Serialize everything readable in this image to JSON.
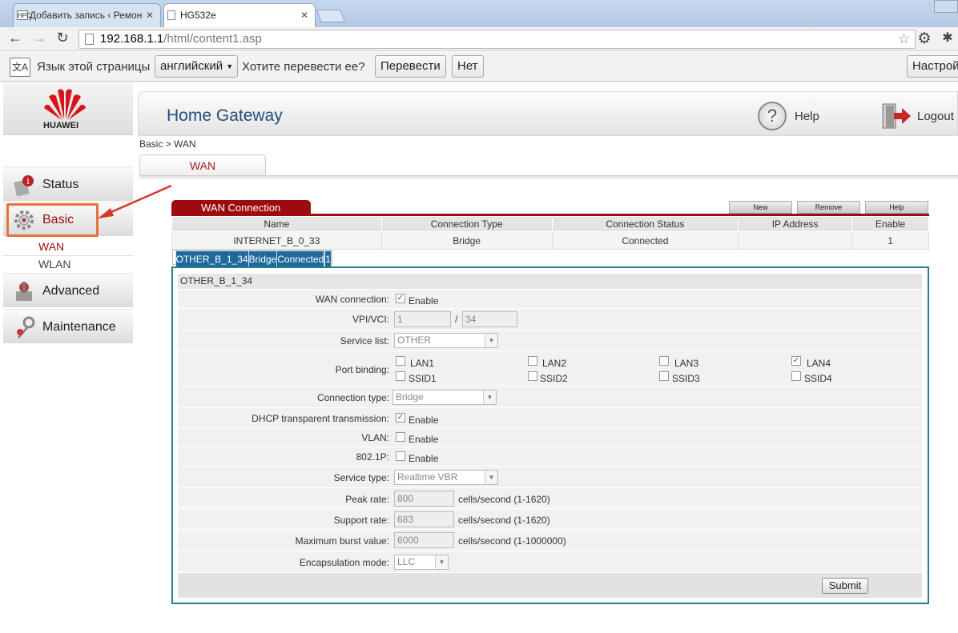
{
  "browser": {
    "tabs": [
      {
        "label": "Добавить запись ‹ Ремон",
        "favicon": "НРС"
      },
      {
        "label": "HG532e"
      }
    ],
    "url_host": "192.168.1.1",
    "url_path": "/html/content1.asp"
  },
  "translate_bar": {
    "language_label": "Язык этой страницы",
    "language_value": "английский",
    "question": "Хотите перевести ее?",
    "translate_btn": "Перевести",
    "no_btn": "Нет",
    "settings_btn": "Настрой"
  },
  "sidebar": {
    "brand": "HUAWEI",
    "items": [
      {
        "label": "Status"
      },
      {
        "label": "Basic"
      },
      {
        "label": "Advanced"
      },
      {
        "label": "Maintenance"
      }
    ],
    "subitems": [
      {
        "label": "WAN"
      },
      {
        "label": "WLAN"
      }
    ]
  },
  "header": {
    "title": "Home Gateway",
    "help": "Help",
    "logout": "Logout"
  },
  "breadcrumb": "Basic > WAN",
  "page_tab": "WAN",
  "wan_table": {
    "title": "WAN Connection",
    "buttons": {
      "new": "New",
      "remove": "Remove",
      "help": "Help"
    },
    "columns": [
      "Name",
      "Connection Type",
      "Connection Status",
      "IP Address",
      "Enable"
    ],
    "rows": [
      [
        "INTERNET_B_0_33",
        "Bridge",
        "Connected",
        "",
        "1"
      ],
      [
        "OTHER_B_1_34",
        "Bridge",
        "Connected",
        "",
        "1"
      ]
    ]
  },
  "form": {
    "title": "OTHER_B_1_34",
    "wan_connection": {
      "label": "WAN connection:",
      "text": "Enable"
    },
    "vpi_vci": {
      "label": "VPI/VCI:",
      "vpi": "1",
      "sep": "/",
      "vci": "34"
    },
    "service_list": {
      "label": "Service list:",
      "value": "OTHER"
    },
    "port_binding": {
      "label": "Port binding:",
      "ports": [
        {
          "name": "LAN1",
          "checked": false
        },
        {
          "name": "LAN2",
          "checked": false
        },
        {
          "name": "LAN3",
          "checked": false
        },
        {
          "name": "LAN4",
          "checked": true
        },
        {
          "name": "SSID1",
          "checked": false
        },
        {
          "name": "SSID2",
          "checked": false
        },
        {
          "name": "SSID3",
          "checked": false
        },
        {
          "name": "SSID4",
          "checked": false
        }
      ]
    },
    "connection_type": {
      "label": "Connection type:",
      "value": "Bridge"
    },
    "dhcp": {
      "label": "DHCP transparent transmission:",
      "text": "Enable"
    },
    "vlan": {
      "label": "VLAN:",
      "text": "Enable"
    },
    "dot1p": {
      "label": "802.1P:",
      "text": "Enable"
    },
    "service_type": {
      "label": "Service type:",
      "value": "Realtime VBR"
    },
    "peak_rate": {
      "label": "Peak rate:",
      "value": "800",
      "unit": "cells/second (1-1620)"
    },
    "support_rate": {
      "label": "Support rate:",
      "value": "683",
      "unit": "cells/second (1-1620)"
    },
    "max_burst": {
      "label": "Maximum burst value:",
      "value": "6000",
      "unit": "cells/second (1-1000000)"
    },
    "encapsulation": {
      "label": "Encapsulation mode:",
      "value": "LLC"
    },
    "submit": "Submit"
  },
  "colors": {
    "accent_red": "#9e0b0f",
    "selected_row": "#1e6a9e",
    "title_blue": "#1f4f7f",
    "annotation": "#e4733e"
  }
}
